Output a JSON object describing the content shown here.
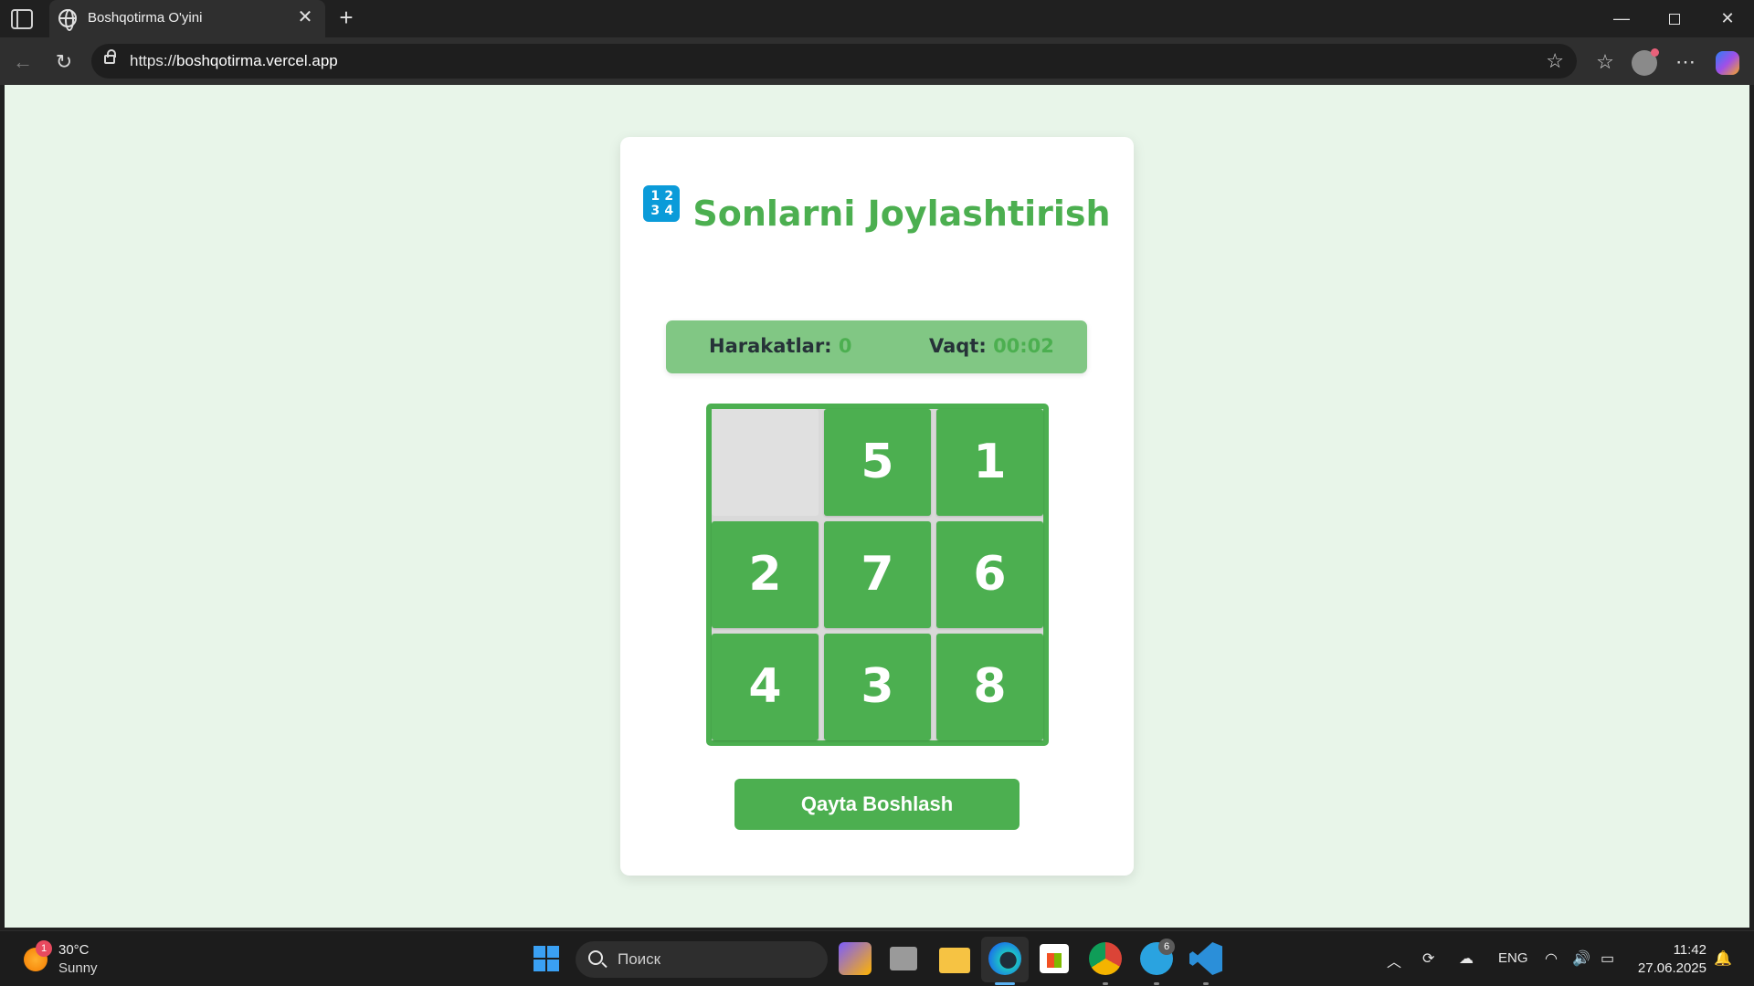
{
  "browser": {
    "tab_title": "Boshqotirma O'yini",
    "tab_close": "✕",
    "new_tab": "+",
    "url_scheme": "https://",
    "url_host": "boshqotirma.vercel.app",
    "window_controls": {
      "minimize": "—",
      "close": "✕"
    },
    "icons": {
      "tab_actions": "tab-actions-icon",
      "globe": "globe-icon",
      "back": "back-arrow-icon",
      "reload": "reload-icon",
      "lock": "lock-icon",
      "favorite": "star-icon",
      "favorites_list": "favorites-icon",
      "profile": "profile-avatar",
      "more": "more-icon",
      "copilot": "copilot-icon"
    }
  },
  "game": {
    "title": "Sonlarni Joylashtirish",
    "title_icon_digits": [
      "1",
      "2",
      "3",
      "4"
    ],
    "moves_label": "Harakatlar:",
    "moves_value": "0",
    "time_label": "Vaqt:",
    "time_value": "00:02",
    "tiles": [
      "",
      "5",
      "1",
      "2",
      "7",
      "6",
      "4",
      "3",
      "8"
    ],
    "restart_label": "Qayta Boshlash",
    "colors": {
      "accent": "#4caf50",
      "stats_bg": "#81c784",
      "page_bg": "#e8f5e9",
      "empty_tile": "#e0e0e0"
    }
  },
  "taskbar": {
    "weather_badge": "1",
    "weather_temp": "30°C",
    "weather_cond": "Sunny",
    "search_placeholder": "Поиск",
    "telegram_badge": "6",
    "language": "ENG",
    "time": "11:42",
    "date": "27.06.2025",
    "apps": [
      "copilot-app-icon",
      "task-view-icon",
      "file-explorer-icon",
      "edge-icon",
      "microsoft-store-icon",
      "chrome-icon",
      "telegram-icon",
      "vscode-icon"
    ]
  }
}
